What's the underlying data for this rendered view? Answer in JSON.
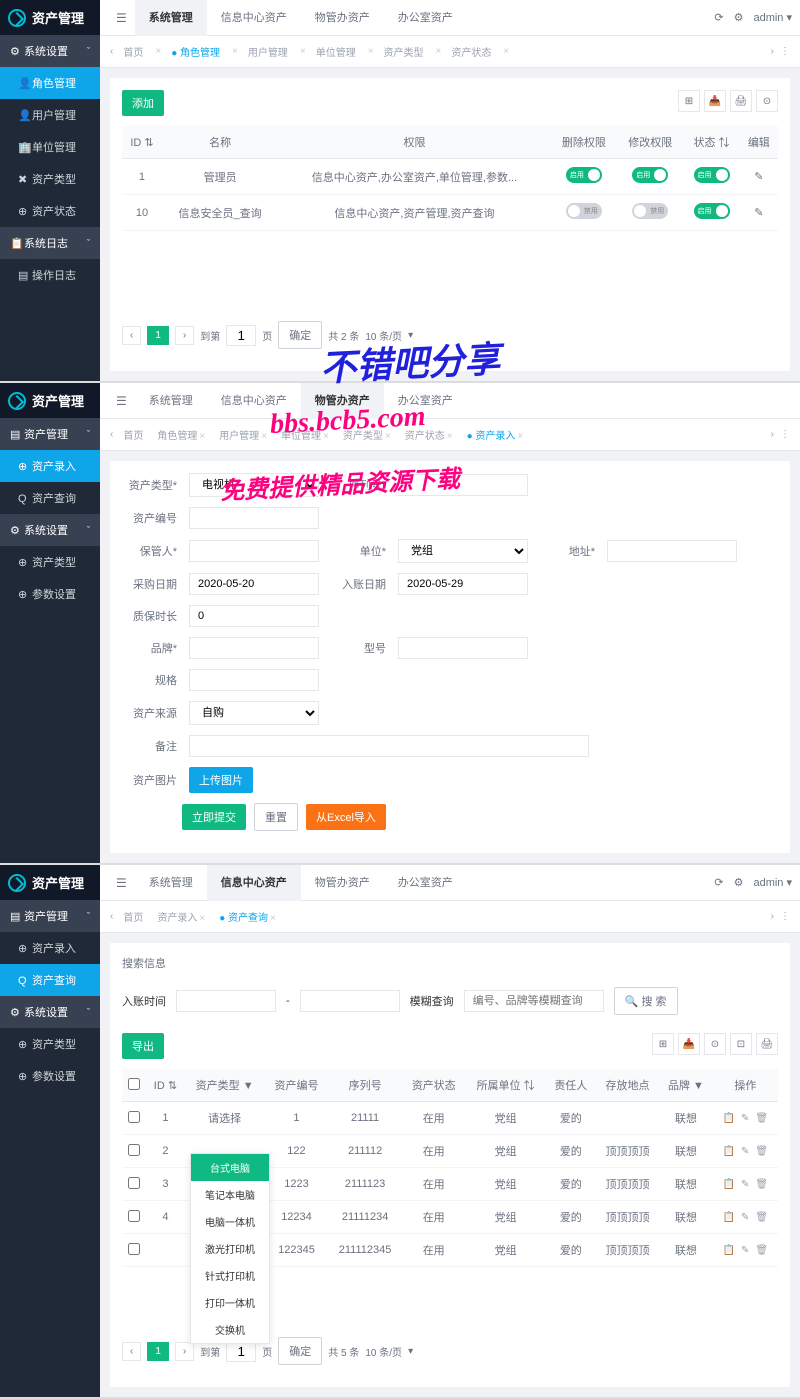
{
  "app_title": "资产管理",
  "user": "admin",
  "screenshot1": {
    "tabs": [
      "系统管理",
      "信息中心资产",
      "物管办资产",
      "办公室资产"
    ],
    "active_tab": 0,
    "sidebar": {
      "sections": [
        {
          "label": "系统设置",
          "icon": "⚙"
        },
        {
          "label": "系统日志",
          "icon": "📋"
        }
      ],
      "items1": [
        {
          "label": "角色管理",
          "icon": "👤",
          "active": true
        },
        {
          "label": "用户管理",
          "icon": "👤"
        },
        {
          "label": "单位管理",
          "icon": "🏢"
        },
        {
          "label": "资产类型",
          "icon": "✖"
        },
        {
          "label": "资产状态",
          "icon": "⊕"
        }
      ],
      "items2": [
        {
          "label": "操作日志",
          "icon": "▤"
        }
      ]
    },
    "breadcrumb": [
      "首页",
      "角色管理",
      "用户管理",
      "单位管理",
      "资产类型",
      "资产状态"
    ],
    "bc_active": 1,
    "add_btn": "添加",
    "table": {
      "headers": [
        "ID",
        "名称",
        "权限",
        "删除权限",
        "修改权限",
        "状态",
        "编辑"
      ],
      "rows": [
        {
          "id": "1",
          "name": "管理员",
          "perm": "信息中心资产,办公室资产,单位管理,参数...",
          "del": true,
          "mod": true,
          "status": true
        },
        {
          "id": "10",
          "name": "信息安全员_查询",
          "perm": "信息中心资产,资产管理,资产查询",
          "del": false,
          "mod": false,
          "status": true
        }
      ]
    },
    "pagination": {
      "goto": "到第",
      "page": "1",
      "unit": "页",
      "confirm": "确定",
      "total": "共 2 条",
      "perpage": "10 条/页"
    }
  },
  "screenshot2": {
    "tabs": [
      "系统管理",
      "信息中心资产",
      "物管办资产",
      "办公室资产"
    ],
    "active_tab": 2,
    "sidebar": {
      "sections": [
        {
          "label": "资产管理",
          "icon": "▤"
        },
        {
          "label": "系统设置",
          "icon": "⚙"
        }
      ],
      "items1": [
        {
          "label": "资产录入",
          "icon": "⊕",
          "active": true
        },
        {
          "label": "资产查询",
          "icon": "Q"
        }
      ],
      "items2": [
        {
          "label": "资产类型",
          "icon": "⊕"
        },
        {
          "label": "参数设置",
          "icon": "⊕"
        }
      ]
    },
    "breadcrumb": [
      "首页",
      "角色管理",
      "用户管理",
      "单位管理",
      "资产类型",
      "资产状态",
      "资产录入"
    ],
    "bc_active": 6,
    "form": {
      "asset_type_label": "资产类型*",
      "asset_type": "电视机",
      "serial_label": "序列号*",
      "asset_no_label": "资产编号",
      "keeper_label": "保管人*",
      "unit_label": "单位*",
      "unit": "党组",
      "location_label": "地址*",
      "buy_date_label": "采购日期",
      "buy_date": "2020-05-20",
      "entry_date_label": "入账日期",
      "entry_date": "2020-05-29",
      "warranty_label": "质保时长",
      "warranty": "0",
      "brand_label": "品牌*",
      "model_label": "型号",
      "spec_label": "规格",
      "source_label": "资产来源",
      "source": "自购",
      "remark_label": "备注",
      "image_label": "资产图片",
      "upload_btn": "上传图片",
      "submit": "立即提交",
      "reset": "重置",
      "import": "从Excel导入"
    }
  },
  "screenshot3": {
    "tabs": [
      "系统管理",
      "信息中心资产",
      "物管办资产",
      "办公室资产"
    ],
    "active_tab": 1,
    "sidebar": {
      "sections": [
        {
          "label": "资产管理",
          "icon": "▤"
        },
        {
          "label": "系统设置",
          "icon": "⚙"
        }
      ],
      "items1": [
        {
          "label": "资产录入",
          "icon": "⊕"
        },
        {
          "label": "资产查询",
          "icon": "Q",
          "active": true
        }
      ],
      "items2": [
        {
          "label": "资产类型",
          "icon": "⊕"
        },
        {
          "label": "参数设置",
          "icon": "⊕"
        }
      ]
    },
    "breadcrumb": [
      "首页",
      "资产录入",
      "资产查询"
    ],
    "bc_active": 2,
    "search_title": "搜索信息",
    "search": {
      "time_label": "入账时间",
      "fuzzy": "模糊查询",
      "fuzzy_ph": "编号、品牌等模糊查询",
      "btn": "搜 索"
    },
    "export_btn": "导出",
    "table": {
      "headers": [
        "",
        "ID",
        "资产类型",
        "资产编号",
        "序列号",
        "资产状态",
        "所属单位",
        "责任人",
        "存放地点",
        "品牌",
        "操作"
      ],
      "rows": [
        {
          "id": "1",
          "type": "请选择",
          "no": "1",
          "serial": "21111",
          "status": "在用",
          "unit": "党组",
          "person": "爱的",
          "loc": "",
          "brand": "联想"
        },
        {
          "id": "2",
          "type": "",
          "no": "122",
          "serial": "211112",
          "status": "在用",
          "unit": "党组",
          "person": "爱的",
          "loc": "顶顶顶顶",
          "brand": "联想"
        },
        {
          "id": "3",
          "type": "",
          "no": "1223",
          "serial": "2111123",
          "status": "在用",
          "unit": "党组",
          "person": "爱的",
          "loc": "顶顶顶顶",
          "brand": "联想"
        },
        {
          "id": "4",
          "type": "",
          "no": "12234",
          "serial": "21111234",
          "status": "在用",
          "unit": "党组",
          "person": "爱的",
          "loc": "顶顶顶顶",
          "brand": "联想"
        },
        {
          "id": "",
          "type": "",
          "no": "122345",
          "serial": "211112345",
          "status": "在用",
          "unit": "党组",
          "person": "爱的",
          "loc": "顶顶顶顶",
          "brand": "联想"
        }
      ]
    },
    "dropdown": [
      "台式电脑",
      "笔记本电脑",
      "电脑一体机",
      "激光打印机",
      "针式打印机",
      "打印一体机",
      "交换机"
    ],
    "pagination": {
      "goto": "到第",
      "page": "1",
      "unit": "页",
      "confirm": "确定",
      "total": "共 5 条",
      "perpage": "10 条/页"
    }
  },
  "watermarks": {
    "w1": "不错吧分享",
    "w2": "bbs.bcb5.com",
    "w3": "免费提供精品资源下载"
  },
  "toggle_on": "启用",
  "toggle_off": "禁用"
}
